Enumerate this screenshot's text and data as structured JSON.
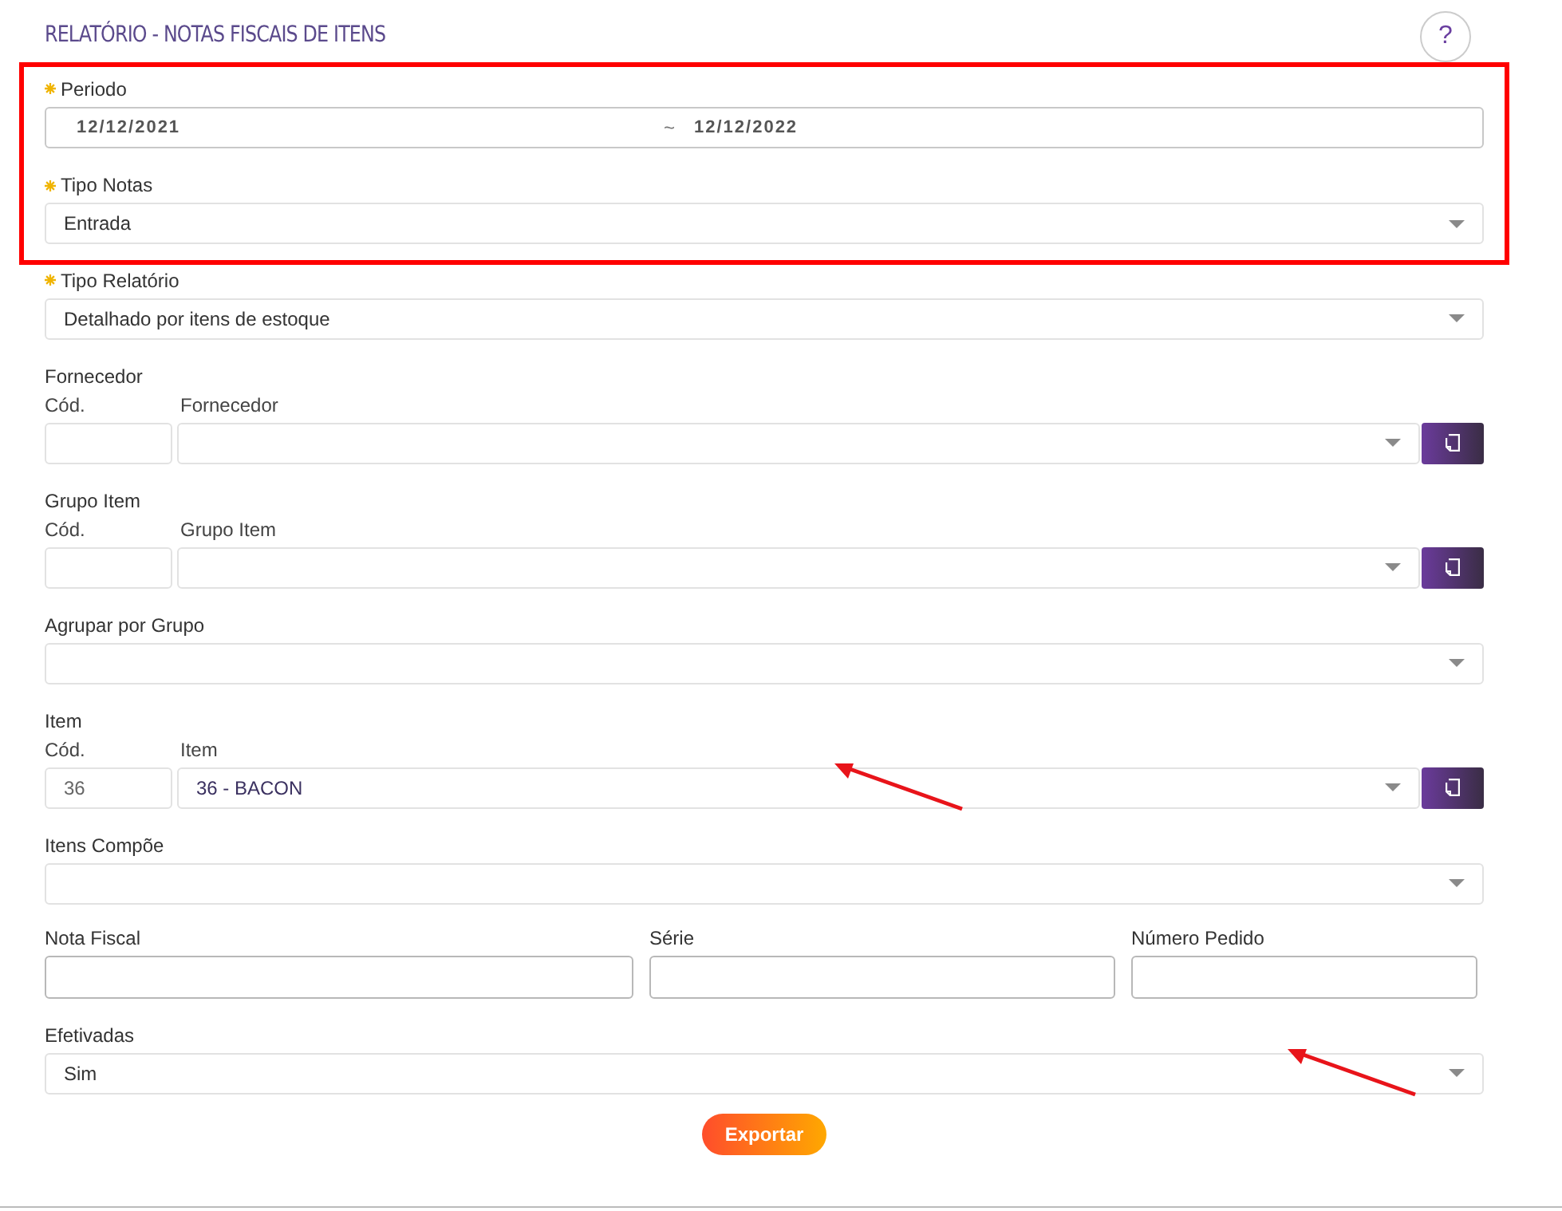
{
  "title": "RELATÓRIO - NOTAS FISCAIS DE ITENS",
  "help_button": "?",
  "sections": [
    {
      "kind": "daterange",
      "label": "Periodo",
      "required": true,
      "highlighted": true,
      "arrow": false,
      "from": "12/12/2021",
      "separator": "~",
      "to": "12/12/2022"
    },
    {
      "kind": "select",
      "label": "Tipo Notas",
      "required": true,
      "highlighted": true,
      "arrow": false,
      "value": "Entrada"
    },
    {
      "kind": "select",
      "label": "Tipo Relatório",
      "required": true,
      "highlighted": false,
      "arrow": false,
      "value": "Detalhado por itens de estoque"
    },
    {
      "kind": "lookup",
      "label": "Fornecedor",
      "required": false,
      "highlighted": false,
      "arrow": false,
      "code_label": "Cód.",
      "name_label": "Fornecedor"
    },
    {
      "kind": "lookup",
      "label": "Grupo Item",
      "required": false,
      "highlighted": false,
      "arrow": false,
      "code_label": "Cód.",
      "name_label": "Grupo Item"
    },
    {
      "kind": "select",
      "label": "Agrupar por Grupo",
      "required": false,
      "highlighted": false,
      "arrow": false
    },
    {
      "kind": "lookup",
      "label": "Item",
      "required": false,
      "highlighted": false,
      "arrow": true,
      "code_label": "Cód.",
      "name_label": "Item",
      "code": "36",
      "value": "36 - BACON"
    },
    {
      "kind": "select",
      "label": "Itens Compõe",
      "required": false,
      "highlighted": false,
      "arrow": false
    },
    {
      "kind": "inputs",
      "required": false,
      "highlighted": false,
      "arrow": false,
      "fields": [
        {
          "label": "Nota Fiscal"
        },
        {
          "label": "Série"
        },
        {
          "label": "Número Pedido"
        }
      ]
    },
    {
      "kind": "select",
      "label": "Efetivadas",
      "required": false,
      "highlighted": false,
      "arrow": true,
      "value": "Sim"
    }
  ],
  "export_button": "Exportar"
}
